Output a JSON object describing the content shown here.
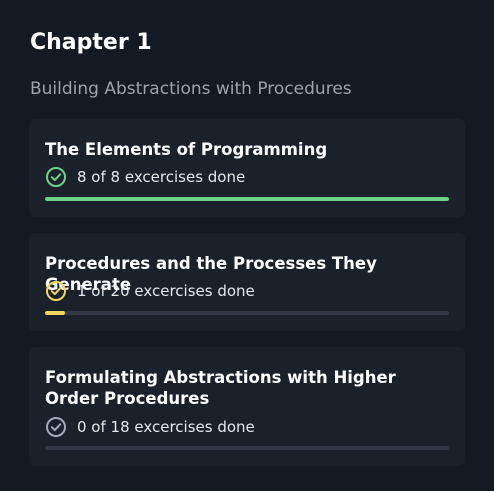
{
  "chapter": {
    "title": "Chapter 1",
    "subtitle": "Building Abstractions with Procedures"
  },
  "sections": [
    {
      "title": "The Elements of Programming",
      "status_text": "8 of 8 excercises done",
      "done": 8,
      "total": 8,
      "color": "#6ad48b",
      "icon": "check-circle-icon"
    },
    {
      "title": "Procedures and the Processes They Generate",
      "status_text": "1 of 20 excercises done",
      "done": 1,
      "total": 20,
      "color": "#f3d75c",
      "icon": "check-circle-icon"
    },
    {
      "title": "Formulating Abstractions with Higher Order Procedures",
      "status_text": "0 of 18 excercises done",
      "done": 0,
      "total": 18,
      "color": "#a3abb8",
      "icon": "check-circle-icon"
    }
  ]
}
